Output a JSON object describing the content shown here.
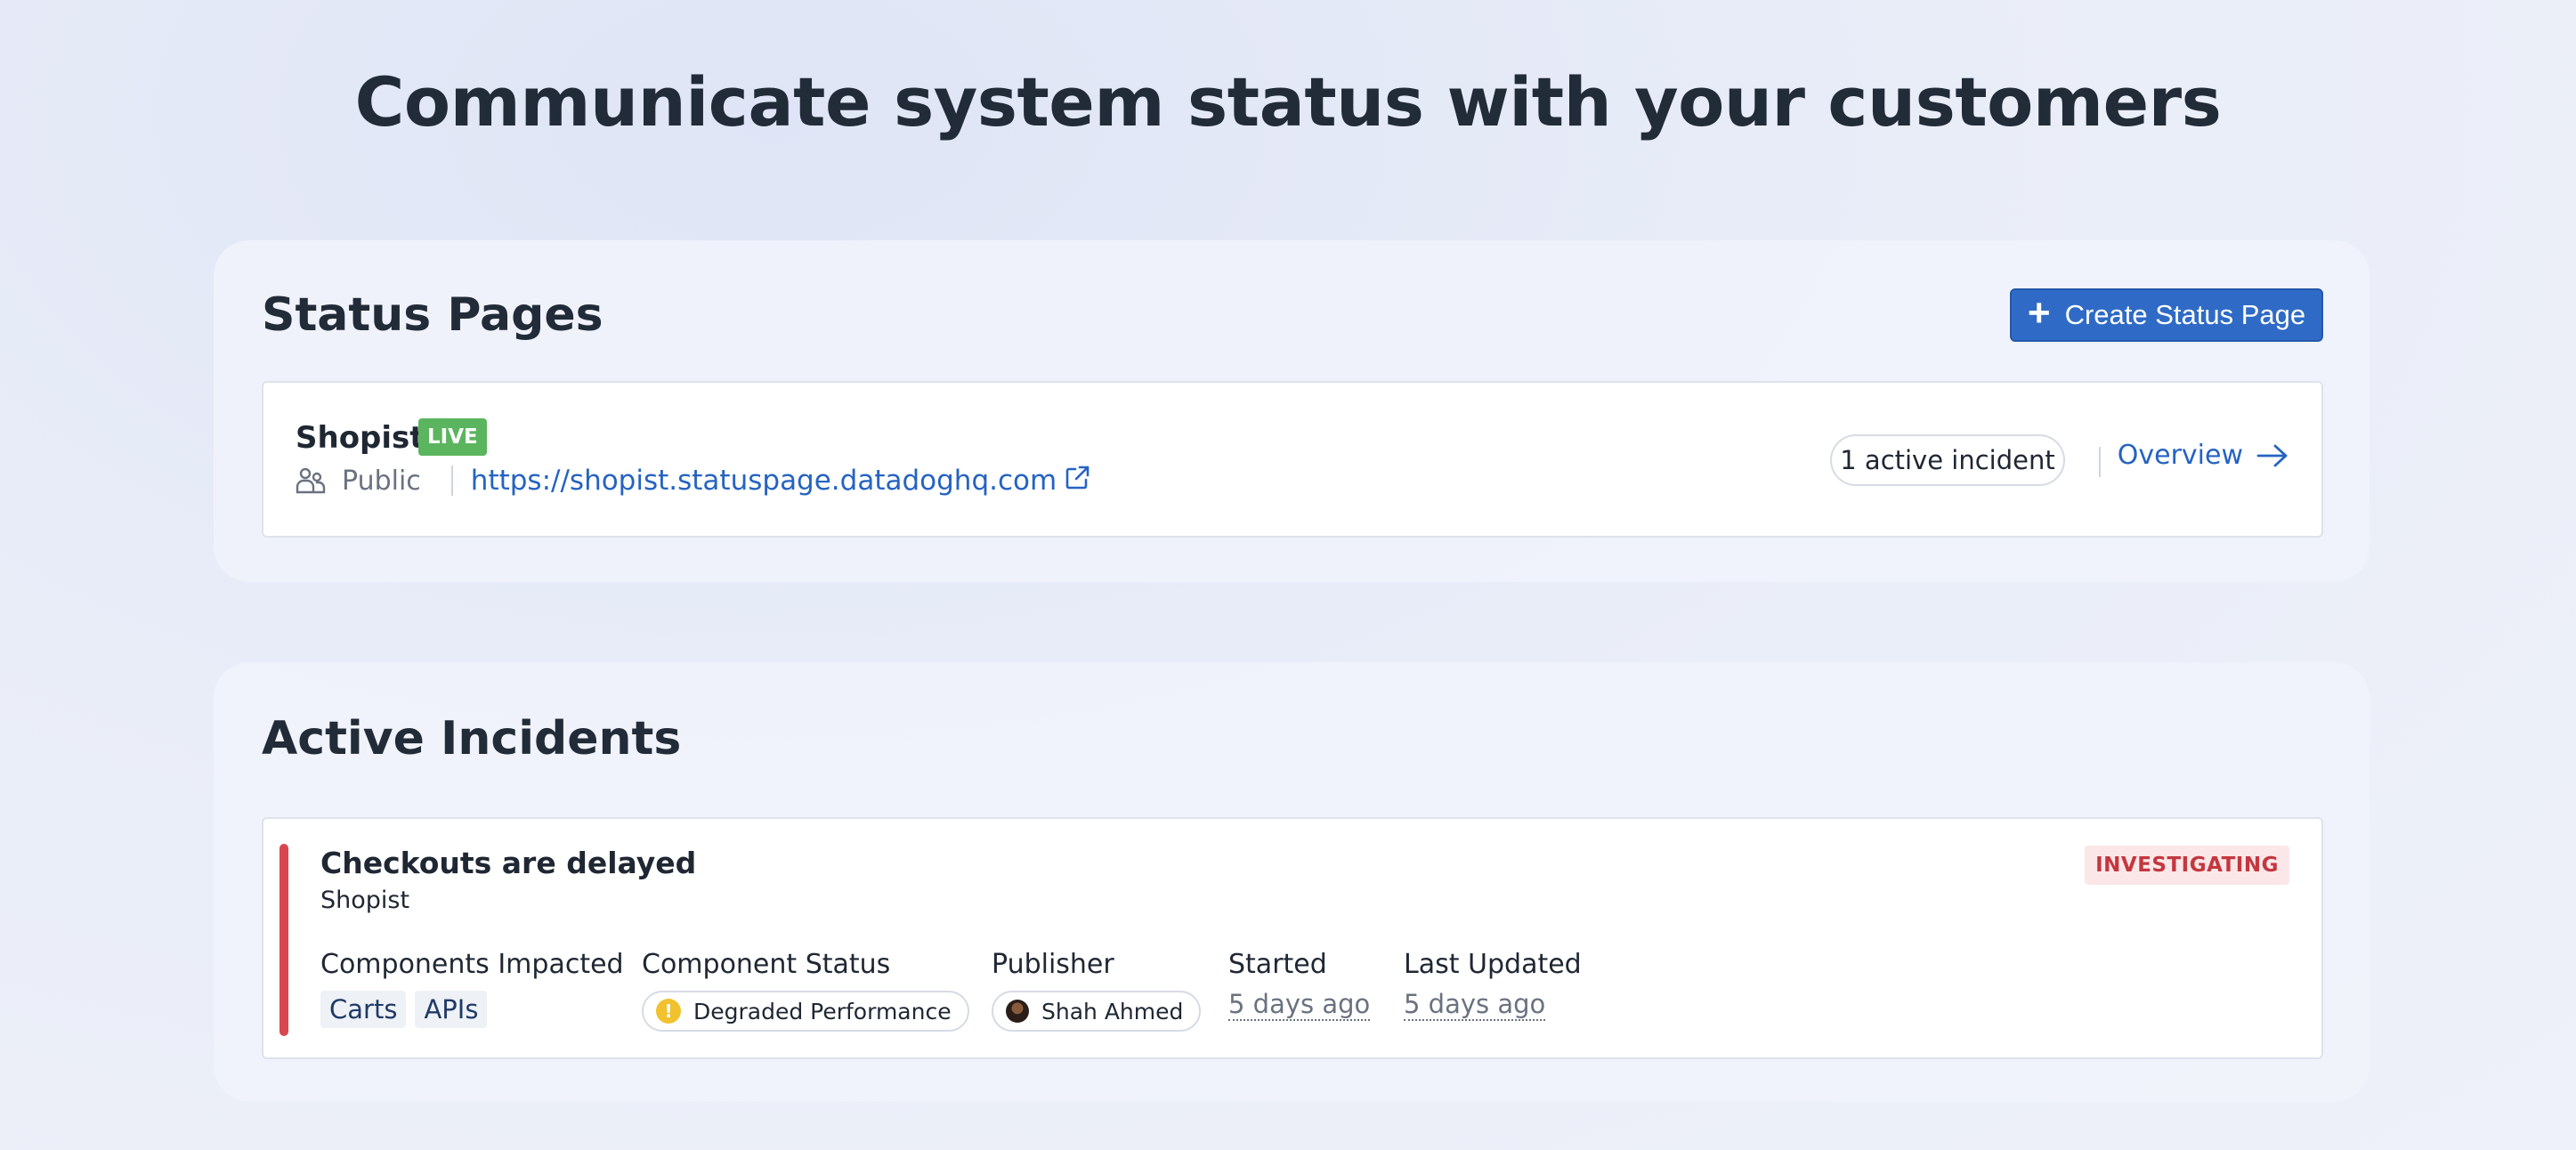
{
  "page": {
    "title": "Communicate system status with your customers"
  },
  "status_pages": {
    "title": "Status Pages",
    "create_label": "Create Status Page",
    "items": [
      {
        "name": "Shopist",
        "badge": "LIVE",
        "visibility": "Public",
        "url": "https://shopist.statuspage.datadoghq.com",
        "active_incidents": "1 active incident",
        "overview_label": "Overview"
      }
    ]
  },
  "active_incidents": {
    "title": "Active Incidents",
    "items": [
      {
        "title": "Checkouts are delayed",
        "page": "Shopist",
        "state": "INVESTIGATING",
        "labels": {
          "components": "Components Impacted",
          "component_status": "Component Status",
          "publisher": "Publisher",
          "started": "Started",
          "last_updated": "Last Updated"
        },
        "components": [
          "Carts",
          "APIs"
        ],
        "component_status": "Degraded Performance",
        "publisher": "Shah Ahmed",
        "started": "5 days ago",
        "last_updated": "5 days ago"
      }
    ]
  },
  "colors": {
    "accent": "#2f6bc6",
    "live": "#5ab55e",
    "investigating": "#c4373f",
    "severity": "#d8474e",
    "warning": "#f0c22e"
  }
}
